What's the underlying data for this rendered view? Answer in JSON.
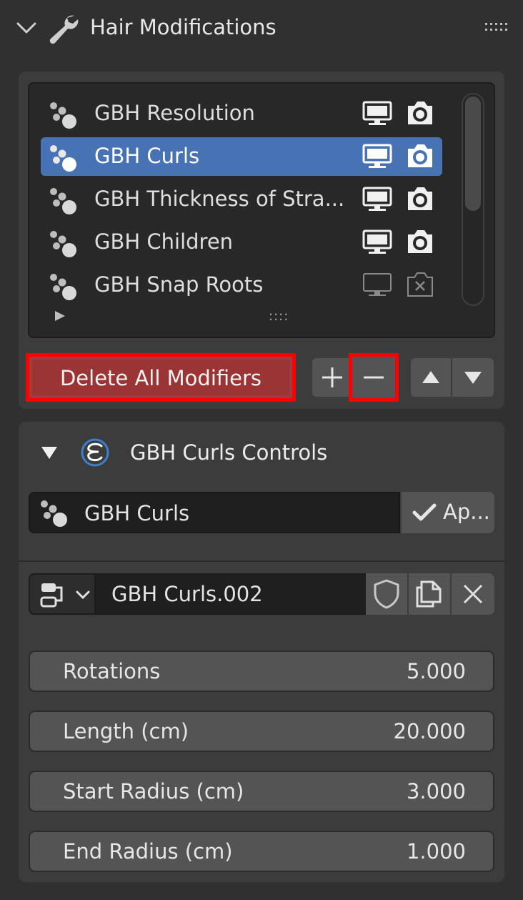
{
  "header": {
    "title": "Hair Modifications",
    "collapse_icon": "chevron-down-icon",
    "icon": "wrench-icon",
    "grip_icon": "drag-grip-icon"
  },
  "modifier_list": {
    "items": [
      {
        "label": "GBH Resolution",
        "active": false,
        "viewport_enabled": true,
        "render_enabled": true
      },
      {
        "label": "GBH Curls",
        "active": true,
        "viewport_enabled": true,
        "render_enabled": true
      },
      {
        "label": "GBH Thickness of Stra...",
        "active": false,
        "viewport_enabled": true,
        "render_enabled": true
      },
      {
        "label": "GBH Children",
        "active": false,
        "viewport_enabled": true,
        "render_enabled": true
      },
      {
        "label": "GBH Snap Roots",
        "active": false,
        "viewport_enabled": false,
        "render_enabled": false
      }
    ],
    "grip_label": "::::"
  },
  "buttons": {
    "delete_all": "Delete All Modifiers",
    "add": "+",
    "remove": "−"
  },
  "controls": {
    "title": "GBH Curls Controls",
    "modifier_name": "GBH Curls",
    "apply_label": "Ap...",
    "node_group_name": "GBH Curls.002"
  },
  "properties": [
    {
      "label": "Rotations",
      "value": "5.000"
    },
    {
      "label": "Length (cm)",
      "value": "20.000"
    },
    {
      "label": "Start Radius (cm)",
      "value": "3.000"
    },
    {
      "label": "End Radius (cm)",
      "value": "1.000"
    }
  ],
  "colors": {
    "active_row": "#4772b3",
    "delete_button": "#9b3535",
    "highlight_outline": "#ff0000"
  }
}
